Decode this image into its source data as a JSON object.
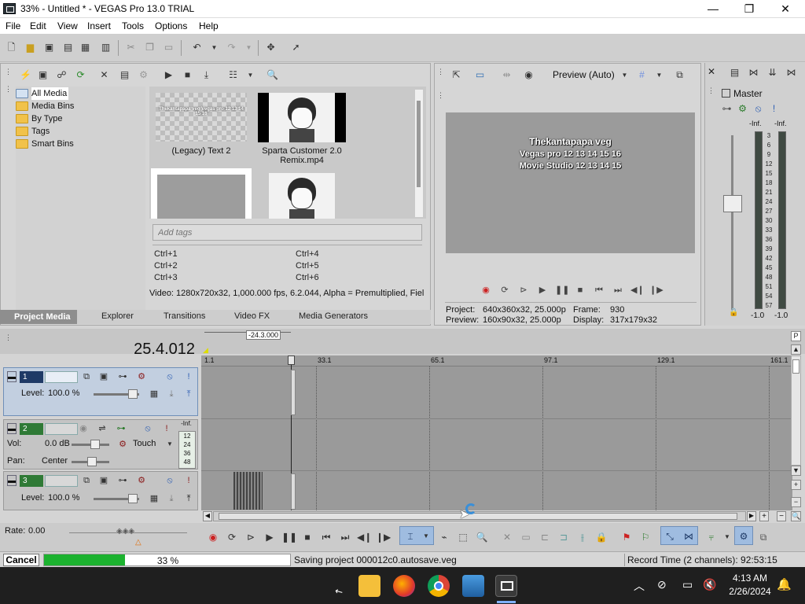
{
  "window": {
    "title": "33% - Untitled * - VEGAS Pro 13.0 TRIAL",
    "minimize": "—",
    "maximize": "❐",
    "close": "✕"
  },
  "menu": [
    "File",
    "Edit",
    "View",
    "Insert",
    "Tools",
    "Options",
    "Help"
  ],
  "media_tree": {
    "items": [
      "All Media",
      "Media Bins",
      "By Type",
      "Tags",
      "Smart Bins"
    ],
    "expander": "+"
  },
  "media": {
    "items": [
      {
        "caption": "(Legacy) Text 2",
        "thumb_text": "Thekantapapa veg Vegas pro 12 13 14 15 16"
      },
      {
        "caption": "Sparta Customer 2.0 Remix.mp4",
        "thumb_text": ""
      }
    ],
    "tags_placeholder": "Add tags",
    "shortcuts": [
      "Ctrl+1",
      "Ctrl+2",
      "Ctrl+3",
      "Ctrl+4",
      "Ctrl+5",
      "Ctrl+6"
    ],
    "info": "Video: 1280x720x32, 1,000.000 fps, 6.2.044, Alpha = Premultiplied, Fiel"
  },
  "tabs": [
    "Project Media",
    "Explorer",
    "Transitions",
    "Video FX",
    "Media Generators"
  ],
  "preview": {
    "mode": "Preview (Auto)",
    "overlay": [
      "Thekantapapa veg",
      "Vegas pro 12 13 14 15 16",
      "Movie Studio 12 13 14 15"
    ],
    "project_label": "Project:",
    "project_value": "640x360x32, 25.000p",
    "preview_label": "Preview:",
    "preview_value": "160x90x32, 25.000p",
    "frame_label": "Frame:",
    "frame_value": "930",
    "display_label": "Display:",
    "display_value": "317x179x32"
  },
  "mixer": {
    "title": "Master",
    "peak_left": "-Inf.",
    "peak_right": "-Inf.",
    "scale": [
      "3",
      "6",
      "9",
      "12",
      "15",
      "18",
      "21",
      "24",
      "27",
      "30",
      "33",
      "36",
      "39",
      "42",
      "45",
      "48",
      "51",
      "54",
      "57"
    ],
    "db_left": "-1.0",
    "db_right": "-1.0"
  },
  "timeline": {
    "timecode": "25.4.012",
    "cursor_label": "-24.3.000",
    "ruler": [
      "1.1",
      "33.1",
      "65.1",
      "97.1",
      "129.1",
      "161.1"
    ],
    "tracks": [
      {
        "number": "1",
        "level_label": "Level:",
        "level_value": "100.0 %"
      },
      {
        "number": "2",
        "vol_label": "Vol:",
        "vol_value": "0.0 dB",
        "pan_label": "Pan:",
        "pan_value": "Center",
        "automation": "Touch",
        "peak": "-Inf.",
        "meter_scale": [
          "12",
          "24",
          "36",
          "48"
        ]
      },
      {
        "number": "3",
        "level_label": "Level:",
        "level_value": "100.0 %"
      }
    ]
  },
  "transport": {
    "rate_label": "Rate:",
    "rate_value": "0.00"
  },
  "status": {
    "cancel": "Cancel",
    "progress_label": "33 %",
    "progress": 0.33,
    "message": "Saving project 000012c0.autosave.veg",
    "record_time": "Record Time (2 channels): 92:53:15"
  },
  "taskbar": {
    "time": "4:13 AM",
    "date": "2/26/2024"
  },
  "colors": {
    "progress_fill": "#1cb22f",
    "active_tab": "#8e8e8e",
    "selected_track": "#c2cfe0"
  }
}
